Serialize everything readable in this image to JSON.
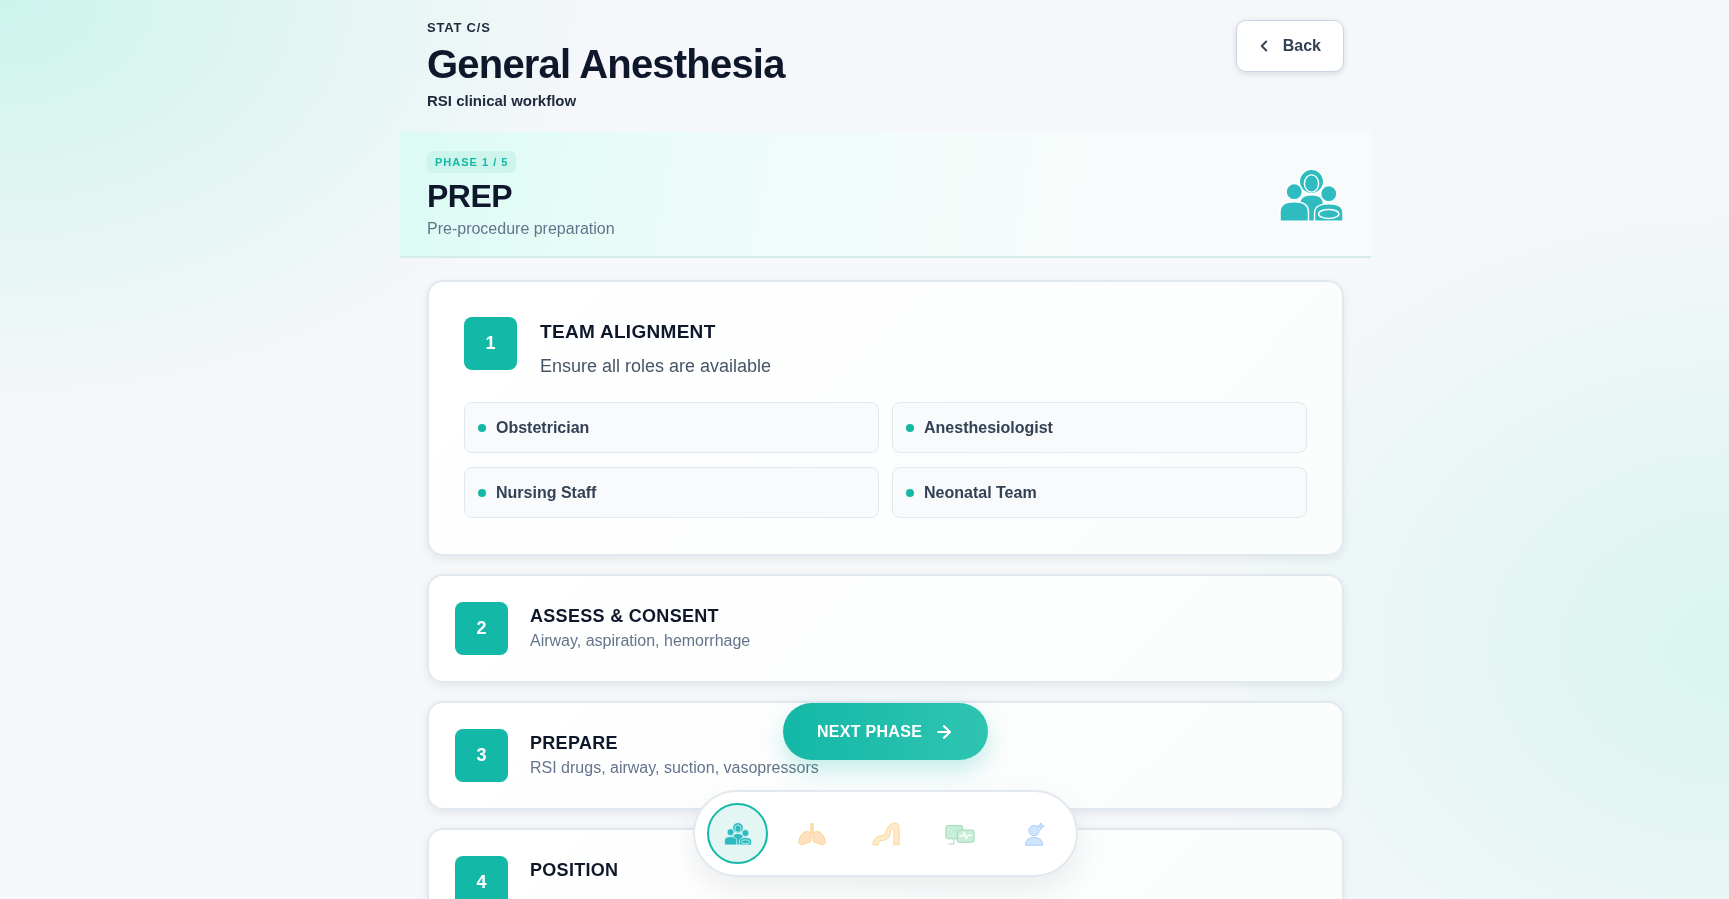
{
  "header": {
    "eyebrow": "STAT C/S",
    "title": "General Anesthesia",
    "subtitle": "RSI clinical workflow"
  },
  "back_button": {
    "label": "Back"
  },
  "phase": {
    "badge": "PHASE 1 / 5",
    "title": "PREP",
    "subtitle": "Pre-procedure preparation"
  },
  "steps": [
    {
      "number": "1",
      "title": "TEAM ALIGNMENT",
      "subtitle": "Ensure all roles are available",
      "expanded": true,
      "items": [
        "Obstetrician",
        "Anesthesiologist",
        "Nursing Staff",
        "Neonatal Team"
      ]
    },
    {
      "number": "2",
      "title": "ASSESS & CONSENT",
      "subtitle": "Airway, aspiration, hemorrhage",
      "expanded": false
    },
    {
      "number": "3",
      "title": "PREPARE",
      "subtitle": "RSI drugs, airway, suction, vasopressors",
      "expanded": false
    },
    {
      "number": "4",
      "title": "POSITION",
      "expanded": false
    }
  ],
  "next_button": {
    "label": "NEXT PHASE"
  },
  "phase_nav": [
    {
      "kind": "team",
      "selected": true
    },
    {
      "kind": "lungs",
      "selected": false
    },
    {
      "kind": "tube",
      "selected": false
    },
    {
      "kind": "monitor",
      "selected": false
    },
    {
      "kind": "person",
      "selected": false
    }
  ]
}
